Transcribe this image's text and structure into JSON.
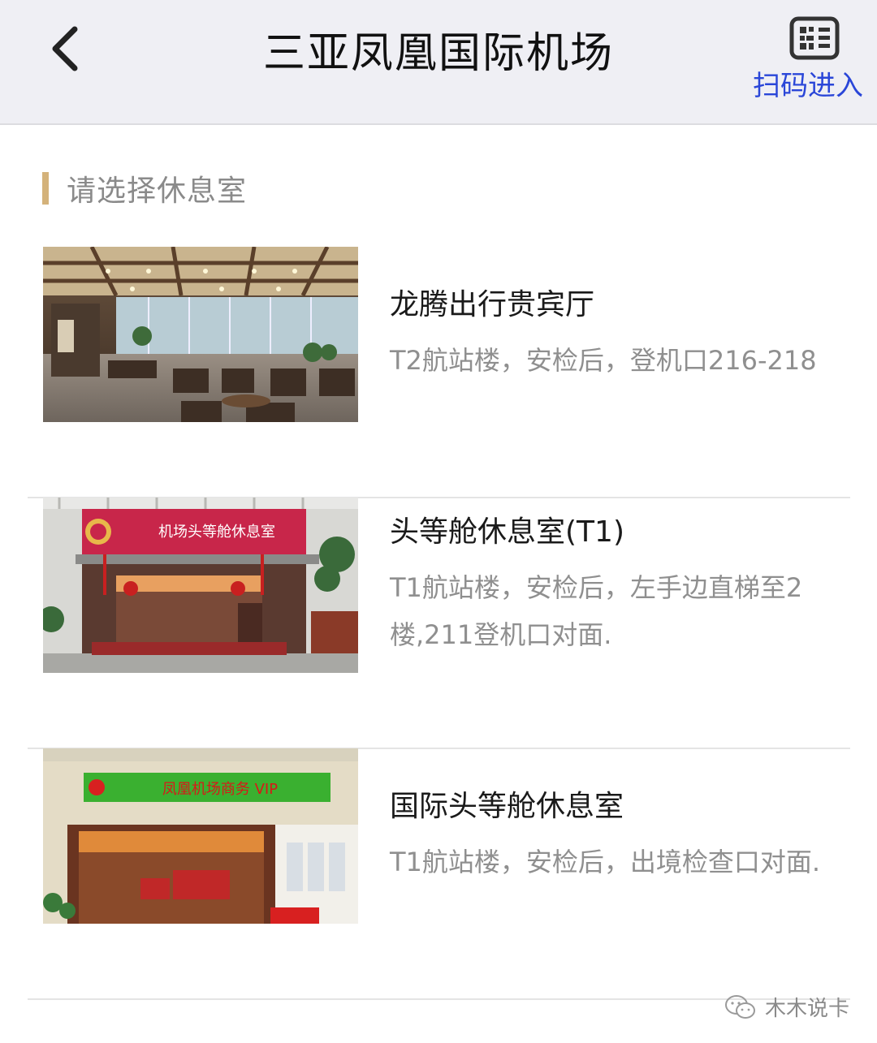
{
  "header": {
    "title": "三亚凤凰国际机场",
    "back_icon": "chevron-left-icon",
    "scan_icon": "qr-code-icon",
    "scan_label": "扫码进入"
  },
  "section": {
    "title": "请选择休息室"
  },
  "lounges": [
    {
      "name": "龙腾出行贵宾厅",
      "location": "T2航站楼，安检后，登机口216-218"
    },
    {
      "name": "头等舱休息室(T1)",
      "location": "T1航站楼，安检后，左手边直梯至2楼,211登机口对面.",
      "sign_text": "机场头等舱休息室"
    },
    {
      "name": "国际头等舱休息室",
      "location": "T1航站楼，安检后，出境检查口对面.",
      "sign_text": "凤凰机场商务 VIP"
    }
  ],
  "watermark": {
    "text": "木木说卡",
    "icon": "wechat-icon"
  },
  "colors": {
    "header_bg": "#efeff4",
    "accent_bar": "#d4b27a",
    "link_blue": "#2a46d8",
    "secondary_text": "#8f8f8f"
  }
}
